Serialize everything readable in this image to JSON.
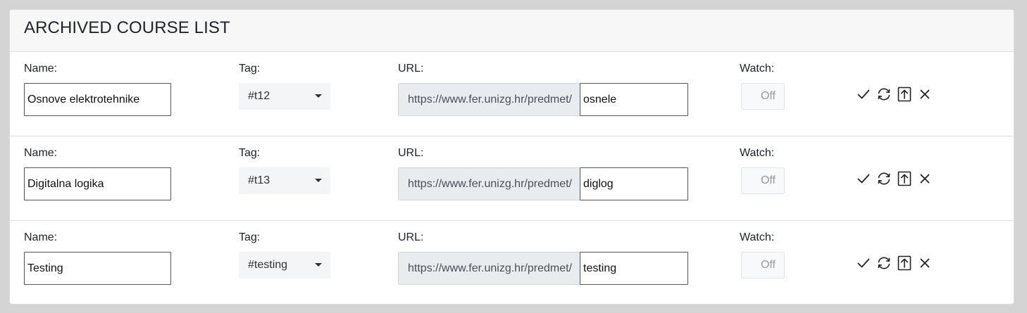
{
  "card": {
    "title": "ARCHIVED COURSE LIST"
  },
  "labels": {
    "name": "Name:",
    "tag": "Tag:",
    "url": "URL:",
    "watch": "Watch:"
  },
  "courses": [
    {
      "name": "Osnove elektrotehnike",
      "tag": "#t12",
      "url_prefix": "https://www.fer.unizg.hr/predmet/",
      "url_slug": "osnele",
      "watch": "Off"
    },
    {
      "name": "Digitalna logika",
      "tag": "#t13",
      "url_prefix": "https://www.fer.unizg.hr/predmet/",
      "url_slug": "diglog",
      "watch": "Off"
    },
    {
      "name": "Testing",
      "tag": "#testing",
      "url_prefix": "https://www.fer.unizg.hr/predmet/",
      "url_slug": "testing",
      "watch": "Off"
    }
  ],
  "actions": [
    "check-icon",
    "refresh-icon",
    "upload-icon",
    "close-icon"
  ],
  "colors": {
    "page_background": "#d4d4d4",
    "header_background": "#f7f7f7",
    "prefix_background": "#e9ecef",
    "select_background": "#f4f5f6"
  }
}
